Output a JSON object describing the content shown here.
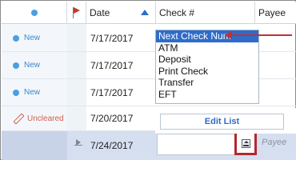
{
  "header": {
    "date_label": "Date",
    "check_label": "Check #",
    "payee_label": "Payee"
  },
  "rows": [
    {
      "status": "New",
      "date": "7/17/2017"
    },
    {
      "status": "New",
      "date": "7/17/2017"
    },
    {
      "status": "New",
      "date": "7/17/2017"
    },
    {
      "status": "Uncleared",
      "date": "7/20/2017"
    },
    {
      "status": "",
      "date": "7/24/2017"
    }
  ],
  "dropdown": {
    "items": [
      "Next Check Num",
      "ATM",
      "Deposit",
      "Print Check",
      "Transfer",
      "EFT"
    ],
    "selected_index": 0,
    "edit_label": "Edit List"
  },
  "new_entry": {
    "check_value": "",
    "payee_placeholder": "Payee"
  },
  "colors": {
    "new_status": "#3b88c9",
    "uncleared_status": "#d35f4a",
    "selection": "#2f6cc8",
    "annotation": "#c0303a"
  }
}
